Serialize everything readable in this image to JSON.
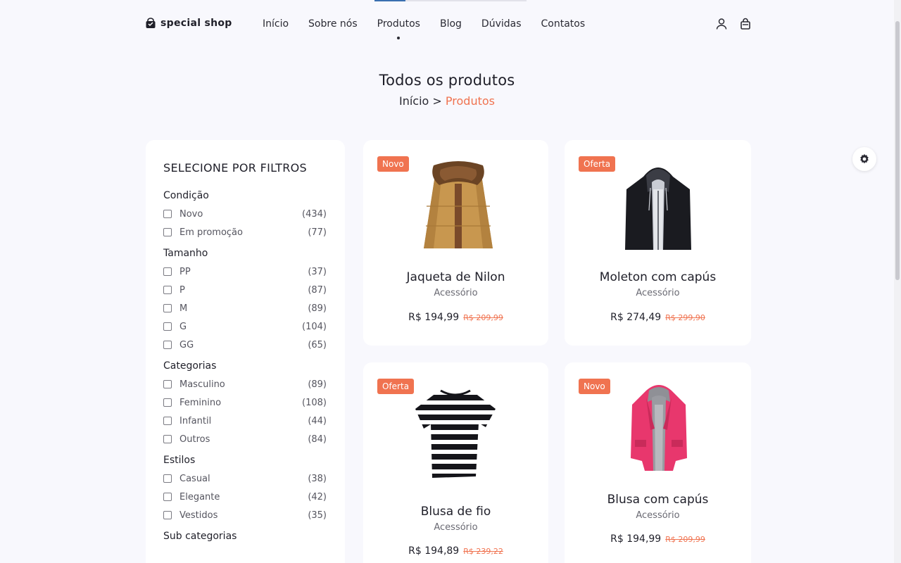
{
  "header": {
    "logo_text": "special shop",
    "nav": [
      {
        "label": "Início"
      },
      {
        "label": "Sobre nós"
      },
      {
        "label": "Produtos"
      },
      {
        "label": "Blog"
      },
      {
        "label": "Dúvidas"
      },
      {
        "label": "Contatos"
      }
    ],
    "active_nav": "Produtos",
    "icons": [
      "user-icon",
      "shopping-bag-icon"
    ]
  },
  "page": {
    "title": "Todos os produtos",
    "breadcrumb": {
      "home": "Início",
      "separator": ">",
      "current": "Produtos"
    }
  },
  "filters": {
    "title": "SELECIONE POR FILTROS",
    "groups": [
      {
        "title": "Condição",
        "options": [
          {
            "label": "Novo",
            "count": "(434)"
          },
          {
            "label": "Em promoção",
            "count": "(77)"
          }
        ]
      },
      {
        "title": "Tamanho",
        "options": [
          {
            "label": "PP",
            "count": "(37)"
          },
          {
            "label": "P",
            "count": "(87)"
          },
          {
            "label": "M",
            "count": "(89)"
          },
          {
            "label": "G",
            "count": "(104)"
          },
          {
            "label": "GG",
            "count": "(65)"
          }
        ]
      },
      {
        "title": "Categorias",
        "options": [
          {
            "label": "Masculino",
            "count": "(89)"
          },
          {
            "label": "Feminino",
            "count": "(108)"
          },
          {
            "label": "Infantil",
            "count": "(44)"
          },
          {
            "label": "Outros",
            "count": "(84)"
          }
        ]
      },
      {
        "title": "Estilos",
        "options": [
          {
            "label": "Casual",
            "count": "(38)"
          },
          {
            "label": "Elegante",
            "count": "(42)"
          },
          {
            "label": "Vestidos",
            "count": "(35)"
          }
        ]
      },
      {
        "title": "Sub categorias",
        "options": []
      }
    ]
  },
  "products": [
    {
      "badge": "Novo",
      "name": "Jaqueta de Nilon",
      "category": "Acessório",
      "price": "R$ 194,99",
      "old_price": "R$ 209,99"
    },
    {
      "badge": "Oferta",
      "name": "Moleton com capús",
      "category": "Acessório",
      "price": "R$ 274,49",
      "old_price": "R$ 299,90"
    },
    {
      "badge": "Oferta",
      "name": "Blusa de fio",
      "category": "Acessório",
      "price": "R$ 194,89",
      "old_price": "R$ 239,22"
    },
    {
      "badge": "Novo",
      "name": "Blusa com capús",
      "category": "Acessório",
      "price": "R$ 194,99",
      "old_price": "R$ 209,99"
    }
  ],
  "colors": {
    "accent": "#f07350",
    "background": "#f8f8fd",
    "card": "#ffffff",
    "text": "#1f1f29"
  },
  "settings_icon": "gear-icon"
}
